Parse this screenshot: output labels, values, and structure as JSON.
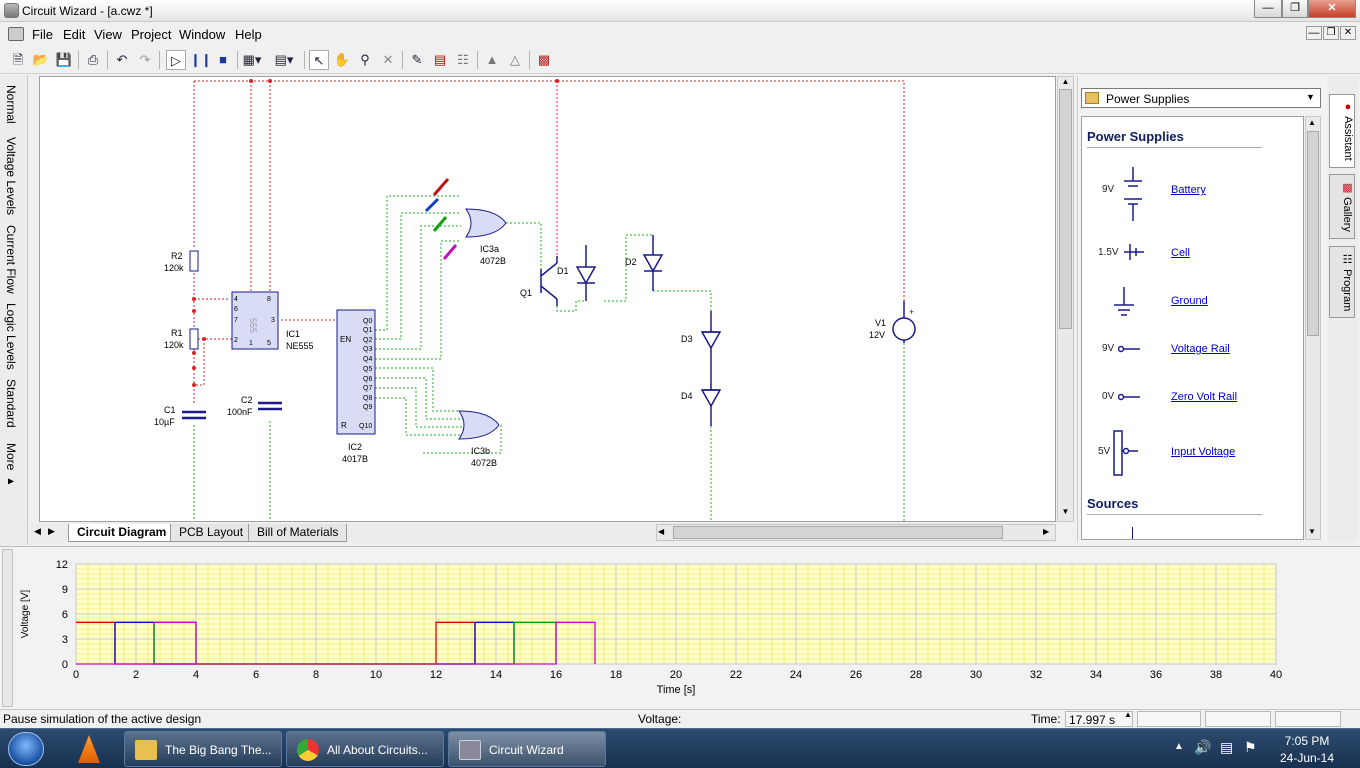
{
  "window": {
    "title": "Circuit Wizard - [a.cwz *]"
  },
  "menu": [
    "File",
    "Edit",
    "View",
    "Project",
    "Window",
    "Help"
  ],
  "left_tabs": [
    "Normal",
    "Voltage Levels",
    "Current Flow",
    "Logic Levels",
    "Standard",
    "More ▸"
  ],
  "circuit": {
    "labels": [
      {
        "id": "r2",
        "text": "R2"
      },
      {
        "id": "r2v",
        "text": "120k"
      },
      {
        "id": "r1",
        "text": "R1"
      },
      {
        "id": "r1v",
        "text": "120k"
      },
      {
        "id": "c1",
        "text": "C1"
      },
      {
        "id": "c1v",
        "text": "10µF"
      },
      {
        "id": "c2",
        "text": "C2"
      },
      {
        "id": "c2v",
        "text": "100nF"
      },
      {
        "id": "ic1",
        "text": "IC1"
      },
      {
        "id": "ic1v",
        "text": "NE555"
      },
      {
        "id": "ic2",
        "text": "IC2"
      },
      {
        "id": "ic2v",
        "text": "4017B"
      },
      {
        "id": "ic3a",
        "text": "IC3a"
      },
      {
        "id": "ic3av",
        "text": "4072B"
      },
      {
        "id": "ic3b",
        "text": "IC3b"
      },
      {
        "id": "ic3bv",
        "text": "4072B"
      },
      {
        "id": "q1",
        "text": "Q1"
      },
      {
        "id": "d1",
        "text": "D1"
      },
      {
        "id": "d2",
        "text": "D2"
      },
      {
        "id": "d3",
        "text": "D3"
      },
      {
        "id": "d4",
        "text": "D4"
      },
      {
        "id": "v1",
        "text": "V1"
      },
      {
        "id": "v1v",
        "text": "12V"
      },
      {
        "id": "chip555",
        "text": "555"
      },
      {
        "id": "en",
        "text": "EN"
      },
      {
        "id": "rpin",
        "text": "R"
      },
      {
        "id": "q10",
        "text": "Q10"
      }
    ],
    "ic2_outputs": [
      "Q0",
      "Q1",
      "Q2",
      "Q3",
      "Q4",
      "Q5",
      "Q6",
      "Q7",
      "Q8",
      "Q9"
    ],
    "ic1_pins": [
      "4",
      "8",
      "7",
      "6",
      "3",
      "2",
      "1",
      "5"
    ]
  },
  "bottom_tabs": [
    "Circuit Diagram",
    "PCB Layout",
    "Bill of Materials"
  ],
  "gallery": {
    "dropdown": "Power Supplies",
    "heading": "Power Supplies",
    "items": [
      {
        "label": "Battery",
        "value": "9V"
      },
      {
        "label": "Cell",
        "value": "1.5V"
      },
      {
        "label": "Ground",
        "value": ""
      },
      {
        "label": "Voltage Rail",
        "value": "9V"
      },
      {
        "label": "Zero Volt Rail",
        "value": "0V"
      },
      {
        "label": "Input Voltage",
        "value": "5V"
      }
    ],
    "section2": "Sources"
  },
  "side_tabs": [
    "Assistant",
    "Gallery",
    "Program"
  ],
  "chart_data": {
    "type": "line",
    "xlabel": "Time [s]",
    "ylabel": "Voltage [V]",
    "xlim": [
      0,
      40
    ],
    "ylim": [
      0,
      12
    ],
    "x_ticks": [
      0,
      2,
      4,
      6,
      8,
      10,
      12,
      14,
      16,
      18,
      20,
      22,
      24,
      26,
      28,
      30,
      32,
      34,
      36,
      38,
      40
    ],
    "y_ticks": [
      0,
      3,
      6,
      9,
      12
    ],
    "grid": true,
    "series": [
      {
        "color": "#e00000",
        "points": [
          [
            0,
            5
          ],
          [
            1.3,
            5
          ],
          [
            1.3,
            0
          ],
          [
            12,
            0
          ],
          [
            12,
            5
          ],
          [
            13.3,
            5
          ],
          [
            13.3,
            0
          ]
        ]
      },
      {
        "color": "#0000e0",
        "points": [
          [
            1.3,
            0
          ],
          [
            1.3,
            5
          ],
          [
            2.6,
            5
          ],
          [
            2.6,
            0
          ],
          [
            13.3,
            0
          ],
          [
            13.3,
            5
          ],
          [
            14.6,
            5
          ],
          [
            14.6,
            0
          ]
        ]
      },
      {
        "color": "#00a000",
        "points": [
          [
            2.6,
            0
          ],
          [
            2.6,
            5
          ],
          [
            4,
            5
          ],
          [
            4,
            0
          ],
          [
            14.6,
            0
          ],
          [
            14.6,
            5
          ],
          [
            16,
            5
          ],
          [
            16,
            0
          ]
        ]
      },
      {
        "color": "#d000d0",
        "points": [
          [
            0,
            0
          ],
          [
            4,
            0
          ],
          [
            4,
            5
          ],
          [
            2.6,
            5
          ],
          [
            4,
            5
          ],
          [
            4,
            0
          ],
          [
            16,
            0
          ],
          [
            16,
            5
          ],
          [
            17.3,
            5
          ],
          [
            17.3,
            0
          ]
        ]
      },
      {
        "color": "#e04040",
        "points": [
          [
            4,
            0
          ],
          [
            12,
            0
          ]
        ]
      }
    ]
  },
  "status": {
    "message": "Pause simulation of the active design",
    "voltage_label": "Voltage:",
    "time_label": "Time:",
    "time_value": "17.997 s"
  },
  "taskbar": {
    "tasks": [
      "The Big Bang The...",
      "All About Circuits...",
      "Circuit Wizard"
    ],
    "time": "7:05 PM",
    "date": "24-Jun-14"
  }
}
